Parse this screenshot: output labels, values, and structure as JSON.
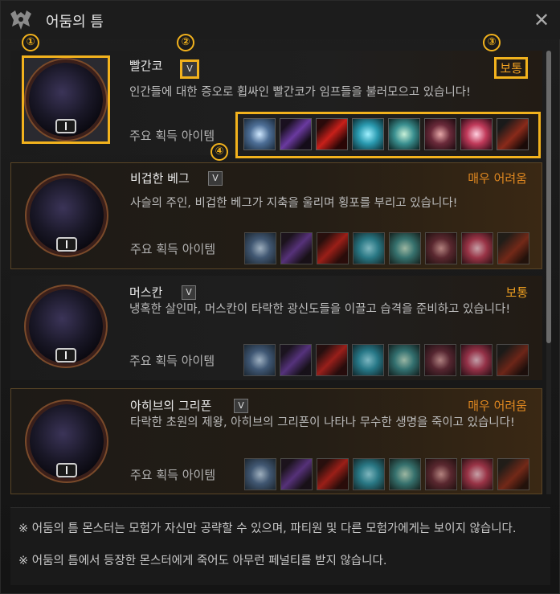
{
  "window": {
    "title": "어둠의 틈",
    "logo_icon": "bat-emblem-icon",
    "close_icon": "close-x-icon"
  },
  "scroll": {
    "thumb_fraction": 0.66
  },
  "items_label": "주요 획득 아이템",
  "item_icons": [
    "ice-orb-icon",
    "purple-gauntlet-icon",
    "red-feather-icon",
    "cyan-orb-icon",
    "teal-orb-icon",
    "pink-crystal-cluster-icon",
    "red-crystal-icon",
    "dark-dagger-icon"
  ],
  "toggle_glyph": "V",
  "orb_badge_icon": "gate-level-badge-icon",
  "monsters": [
    {
      "name": "빨간코",
      "difficulty": "보통",
      "level": "normal",
      "description": "인간들에 대한 증오로 휩싸인 빨간코가 임프들을 불러모으고 있습니다!"
    },
    {
      "name": "비겁한 베그",
      "difficulty": "매우 어려움",
      "level": "hard",
      "description": "사슬의 주인, 비겁한 베그가 지축을 울리며 횡포를 부리고 있습니다!"
    },
    {
      "name": "머스칸",
      "difficulty": "보통",
      "level": "normal",
      "description": "냉혹한 살인마, 머스칸이 타락한 광신도들을 이끌고 습격을 준비하고 있습니다!"
    },
    {
      "name": "아히브의 그리폰",
      "difficulty": "매우 어려움",
      "level": "hard",
      "description": "타락한 초원의 제왕, 아히브의 그리폰이 나타나 무수한 생명을 죽이고 있습니다!"
    }
  ],
  "markers": [
    "①",
    "②",
    "③",
    "④"
  ],
  "footer": {
    "note1": "※ 어둠의 틈 몬스터는 모험가 자신만 공략할 수 있으며, 파티원 및 다른 모험가에게는 보이지 않습니다.",
    "note2": "※ 어둠의 틈에서 등장한 몬스터에게 죽어도 아무런 페널티를 받지 않습니다."
  },
  "colors": {
    "highlight": "#f2b21d",
    "normal": "#f0a020",
    "hard": "#e08820"
  }
}
